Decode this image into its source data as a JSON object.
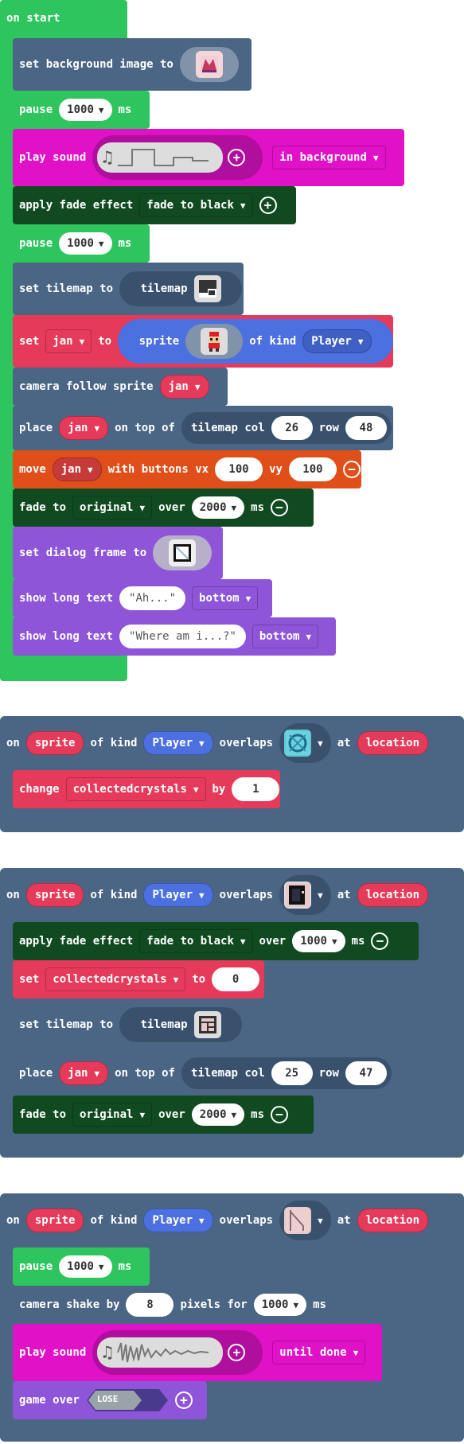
{
  "colors": {
    "events": "#2ec55e",
    "scene": "#4b6584",
    "fade": "#114a21",
    "music": "#e011c6",
    "variables": "#e63a5a",
    "controller": "#e04f1a",
    "dialog": "#8e55d8",
    "sprite": "#4c70e0"
  },
  "on_start": {
    "header": "on start",
    "set_bg": "set background image to",
    "pause": "pause",
    "ms": "ms",
    "pause_value": "1000",
    "play_sound": "play sound",
    "in_background": "in background",
    "apply_fade": "apply fade effect",
    "fade_to_black": "fade to black",
    "set_tilemap": "set tilemap to",
    "tilemap": "tilemap",
    "set": "set",
    "jan": "jan",
    "to": "to",
    "sprite": "sprite",
    "of_kind": "of kind",
    "player": "Player",
    "camera_follow": "camera follow sprite",
    "place": "place",
    "on_top_of": "on top of",
    "tilemap_col": "tilemap col",
    "col_value": "26",
    "row": "row",
    "row_value": "48",
    "move": "move",
    "with_buttons_vx": "with buttons vx",
    "vx_value": "100",
    "vy": "vy",
    "vy_value": "100",
    "fade_to": "fade to",
    "original": "original",
    "over": "over",
    "over_value": "2000",
    "set_dialog_frame": "set dialog frame to",
    "show_long_text": "show long text",
    "text1": "\"Ah...\"",
    "bottom": "bottom",
    "text2": "\"Where am i...?\""
  },
  "overlap1": {
    "on": "on",
    "sprite": "sprite",
    "of_kind": "of kind",
    "player": "Player",
    "overlaps": "overlaps",
    "at": "at",
    "location": "location",
    "change": "change",
    "variable": "collectedcrystals",
    "by": "by",
    "by_value": "1"
  },
  "overlap2": {
    "on": "on",
    "sprite": "sprite",
    "of_kind": "of kind",
    "player": "Player",
    "overlaps": "overlaps",
    "at": "at",
    "location": "location",
    "apply_fade": "apply fade effect",
    "fade_to_black": "fade to black",
    "over": "over",
    "over_value": "1000",
    "ms": "ms",
    "set": "set",
    "variable": "collectedcrystals",
    "to": "to",
    "to_value": "0",
    "set_tilemap": "set tilemap to",
    "tilemap": "tilemap",
    "place": "place",
    "jan": "jan",
    "on_top_of": "on top of",
    "tilemap_col": "tilemap col",
    "col_value": "25",
    "row": "row",
    "row_value": "47",
    "fade_to": "fade to",
    "original": "original",
    "over2_value": "2000"
  },
  "overlap3": {
    "on": "on",
    "sprite": "sprite",
    "of_kind": "of kind",
    "player": "Player",
    "overlaps": "overlaps",
    "at": "at",
    "location": "location",
    "pause": "pause",
    "pause_value": "1000",
    "ms": "ms",
    "camera_shake": "camera shake by",
    "shake_value": "8",
    "pixels_for": "pixels for",
    "for_value": "1000",
    "play_sound": "play sound",
    "until_done": "until done",
    "game_over": "game over",
    "lose": "LOSE"
  }
}
